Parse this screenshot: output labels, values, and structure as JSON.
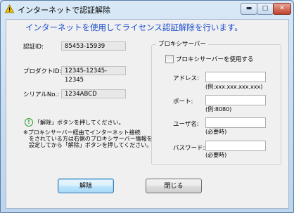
{
  "window": {
    "title": "インターネットで認証解除",
    "min_glyph": "▬",
    "max_glyph": "□",
    "close_glyph": "✕"
  },
  "heading": "インターネットを使用してライセンス認証解除を行います。",
  "fields": {
    "auth_id_label": "認証ID:",
    "auth_id_value": "85453-15939",
    "product_id_label": "プロダクトID:",
    "product_id_value": "12345-12345-12345",
    "serial_label": "シリアルNo.:",
    "serial_value": "1234ABCD"
  },
  "proxy": {
    "legend": "プロキシサーバー",
    "use_proxy_label": "プロキシサーバーを使用する",
    "address_label": "アドレス:",
    "address_hint": "(例:xxx.xxx.xxx.xxx)",
    "port_label": "ポート:",
    "port_hint": "(例:8080)",
    "user_label": "ユーザ名:",
    "user_hint": "(必要時)",
    "password_label": "パスワード:",
    "password_hint": "(必要時)"
  },
  "info": {
    "glyph": "!",
    "message": "「解除」ボタンを押してください。",
    "note_line1": "※プロキシサーバー経由でインターネット接続",
    "note_line2": "　をされている方は右側のプロキシサーバー情報を",
    "note_line3": "　設定してから「解除」ボタンを押してください。"
  },
  "buttons": {
    "release": "解除",
    "close": "閉じる"
  }
}
